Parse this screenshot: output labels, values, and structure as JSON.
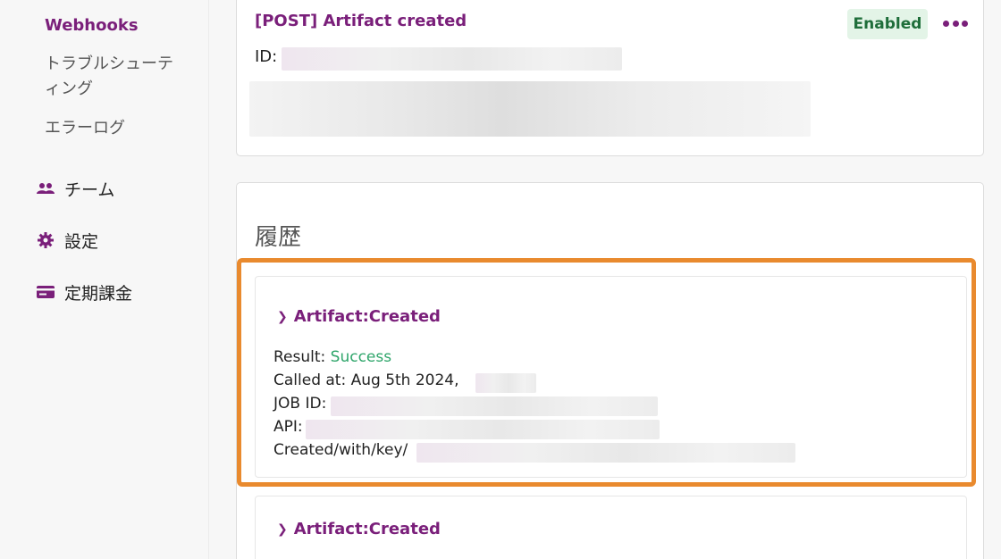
{
  "sidebar": {
    "sub_items": [
      {
        "label": "Webhooks",
        "active": true
      },
      {
        "label": "トラブルシューテ",
        "active": false
      },
      {
        "label": "ィング",
        "active": false
      },
      {
        "label": "エラーログ",
        "active": false
      }
    ],
    "items": [
      {
        "label": "チーム",
        "icon": "team-icon"
      },
      {
        "label": "設定",
        "icon": "gear-icon"
      },
      {
        "label": "定期課金",
        "icon": "credit-card-icon"
      }
    ]
  },
  "webhook": {
    "title": "[POST] Artifact created",
    "status": "Enabled",
    "id_label": "ID:"
  },
  "history": {
    "title": "履歴",
    "entries": [
      {
        "name": "Artifact:Created",
        "result_label": "Result: ",
        "result_value": "Success",
        "called_at": "Called at: Aug 5th 2024,",
        "job_id_label": "JOB ID:",
        "api_label": "API:",
        "created_with_label": "Created/with/key/"
      },
      {
        "name": "Artifact:Created"
      }
    ]
  },
  "colors": {
    "accent": "#7a1f7a",
    "success": "#2ea56a",
    "highlight": "#e98a2e",
    "badge_bg": "#e3f4e7"
  }
}
